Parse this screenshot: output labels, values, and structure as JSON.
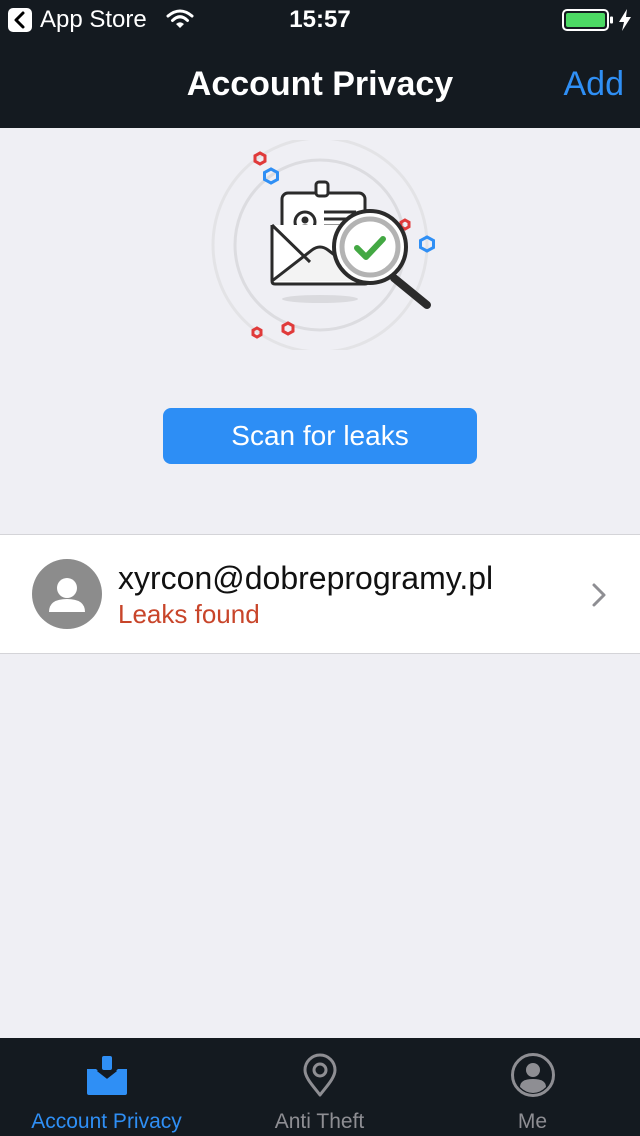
{
  "status_bar": {
    "back_app": "App Store",
    "time": "15:57",
    "icons": [
      "back-chevron-icon",
      "wifi-icon",
      "battery-icon",
      "charging-bolt-icon"
    ]
  },
  "nav": {
    "title": "Account Privacy",
    "add_label": "Add"
  },
  "hero": {
    "icon": "email-scan-illustration"
  },
  "scan_button": {
    "label": "Scan for leaks"
  },
  "accounts": [
    {
      "email": "xyrcon@dobreprogramy.pl",
      "status": "Leaks found",
      "icon": "avatar-placeholder-icon"
    }
  ],
  "tabs": [
    {
      "label": "Account Privacy",
      "icon": "mail-tray-icon",
      "active": true
    },
    {
      "label": "Anti Theft",
      "icon": "location-pin-icon",
      "active": false
    },
    {
      "label": "Me",
      "icon": "user-circle-icon",
      "active": false
    }
  ],
  "colors": {
    "accent": "#2f8ff5",
    "button": "#2d8ef5",
    "bar_background": "#141a20",
    "page_background": "#efeff4",
    "warning_text": "#c8452a",
    "check_green": "#43a843"
  }
}
